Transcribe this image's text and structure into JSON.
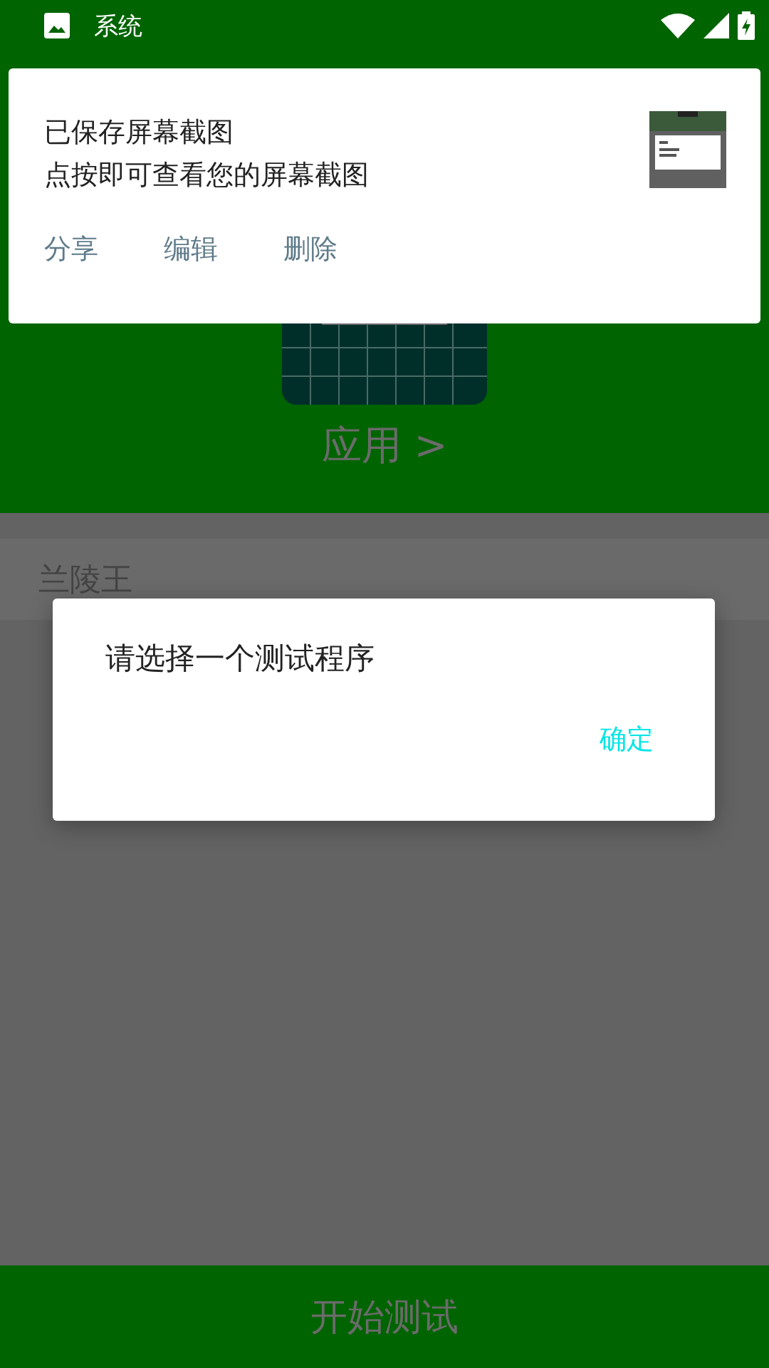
{
  "status_bar": {
    "app_name": "系统"
  },
  "app_header": {
    "link": "应用 >"
  },
  "list": [
    {
      "label": "兰陵王"
    }
  ],
  "start_button": {
    "label": "开始测试"
  },
  "notification": {
    "title": "已保存屏幕截图",
    "text": "点按即可查看您的屏幕截图",
    "actions": [
      "分享",
      "编辑",
      "删除"
    ]
  },
  "dialog": {
    "message": "请选择一个测试程序",
    "button": "确定"
  }
}
